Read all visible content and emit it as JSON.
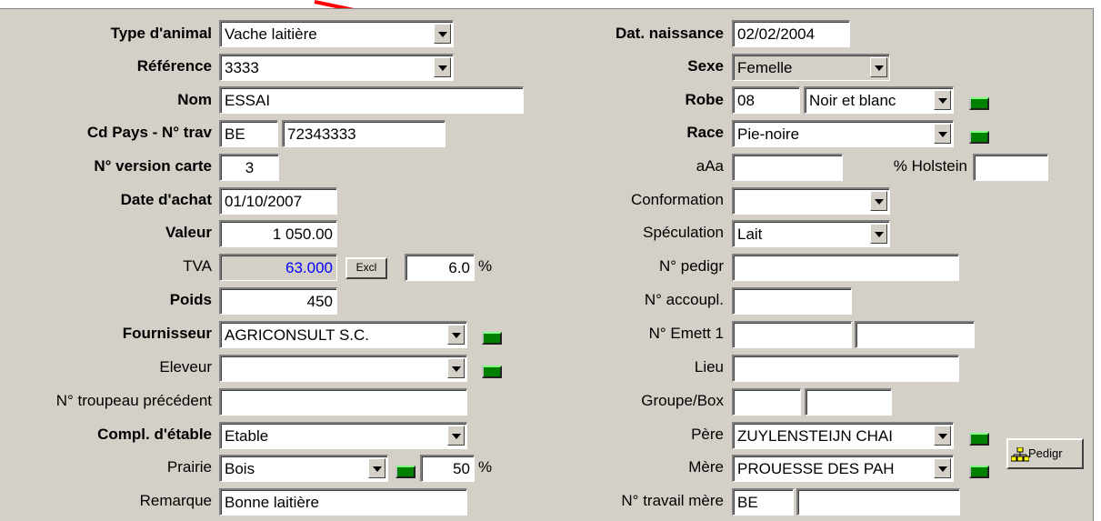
{
  "labels": {
    "type_animal": "Type d'animal",
    "reference": "Référence",
    "nom": "Nom",
    "cd_pays": "Cd Pays - N° trav",
    "version_carte": "N° version carte",
    "date_achat": "Date d'achat",
    "valeur": "Valeur",
    "tva": "TVA",
    "poids": "Poids",
    "fournisseur": "Fournisseur",
    "eleveur": "Eleveur",
    "troupeau": "N° troupeau précédent",
    "compl_etable": "Compl. d'étable",
    "prairie": "Prairie",
    "remarque": "Remarque",
    "dat_naissance": "Dat. naissance",
    "sexe": "Sexe",
    "robe": "Robe",
    "race": "Race",
    "aaa": "aAa",
    "holstein": "% Holstein",
    "conformation": "Conformation",
    "speculation": "Spéculation",
    "pedigr": "N° pedigr",
    "accoupl": "N° accoupl.",
    "emett": "N° Emett 1",
    "lieu": "Lieu",
    "groupe": "Groupe/Box",
    "pere": "Père",
    "mere": "Mère",
    "travail_mere": "N° travail mère"
  },
  "values": {
    "type_animal": "Vache laitière",
    "reference": "3333",
    "nom": "ESSAI",
    "pays": "BE",
    "num_trav": "72343333",
    "version_carte": "3",
    "date_achat": "01/10/2007",
    "valeur": "1 050.00",
    "tva": "63.000",
    "tva_rate": "6.0",
    "poids": "450",
    "fournisseur": "AGRICONSULT S.C.",
    "eleveur": "",
    "troupeau": "",
    "compl_etable": "Etable",
    "prairie": "Bois",
    "prairie_pct": "50",
    "remarque": "Bonne laitière",
    "dat_naissance": "02/02/2004",
    "sexe": "Femelle",
    "robe_code": "08",
    "robe": "Noir et blanc",
    "race": "Pie-noire",
    "aaa": "",
    "holstein": "",
    "conformation": "",
    "speculation": "Lait",
    "pedigr": "",
    "accoupl": "",
    "emett_a": "",
    "emett_b": "",
    "lieu": "",
    "groupe_a": "",
    "groupe_b": "",
    "pere": "ZUYLENSTEIJN CHAI",
    "mere": "PROUESSE DES PAH",
    "travail_mere_pays": "BE",
    "travail_mere_num": ""
  },
  "buttons": {
    "excl": "Excl",
    "pedigr": "Pedigr"
  },
  "units": {
    "percent": "%"
  },
  "colors": {
    "panel": "#d4d0c8",
    "arrow": "#ff0000",
    "green_button": "#008000",
    "tva_value": "#0000ff"
  },
  "icons": {
    "pedigree": "org-chart-icon",
    "annotation": "red-arrow-icon"
  }
}
